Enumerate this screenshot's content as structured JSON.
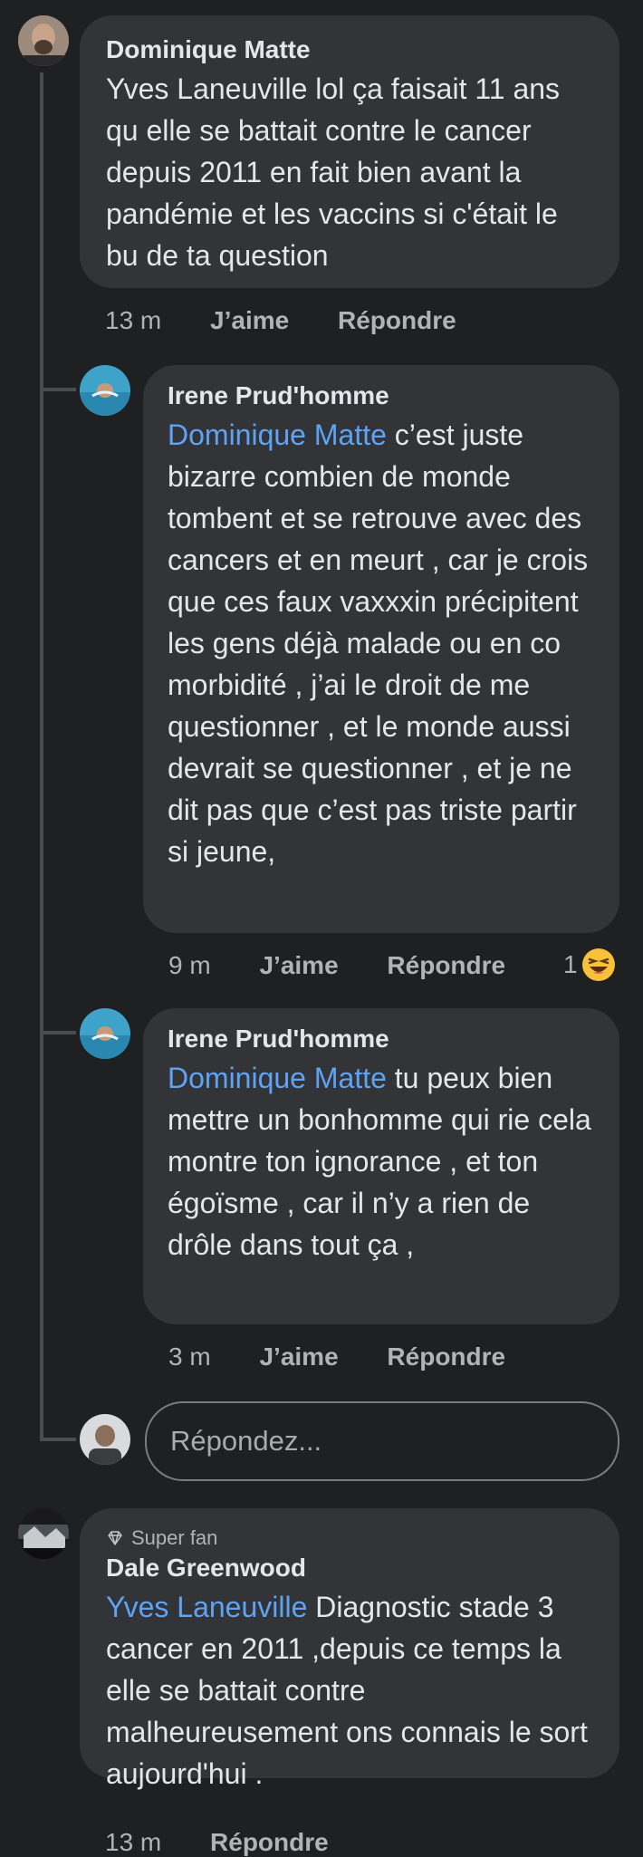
{
  "comments": [
    {
      "author": "Dominique Matte",
      "text": "Yves Laneuville lol ça faisait  11 ans qu elle se battait contre le cancer depuis 2011 en fait bien avant la pandémie et les vaccins si c'était le bu de ta question",
      "time": "13 m",
      "like_label": "J’aime",
      "reply_label": "Répondre"
    },
    {
      "author": "Irene Prud'homme",
      "mention": "Dominique Matte",
      "text": " c’est juste bizarre combien de monde tombent et se retrouve avec des cancers et en meurt , car je crois que ces faux vaxxxin précipitent les gens déjà malade ou en co morbidité , j’ai le droit de me questionner , et le monde aussi devrait se questionner , et je ne dit pas que c’est pas triste partir si jeune,",
      "time": "9 m",
      "like_label": "J’aime",
      "reply_label": "Répondre",
      "reaction_count": "1",
      "reaction_icon": "laughing-face-icon"
    },
    {
      "author": "Irene Prud'homme",
      "mention": "Dominique Matte",
      "text": " tu peux bien mettre un bonhomme qui rie cela montre ton ignorance , et ton égoïsme , car il n’y a rien de drôle dans tout ça ,",
      "time": "3 m",
      "like_label": "J’aime",
      "reply_label": "Répondre"
    },
    {
      "badge_icon": "diamond-icon",
      "badge": "Super fan",
      "author": "Dale Greenwood",
      "mention": "Yves Laneuville",
      "text": " Diagnostic stade 3 cancer en 2011  ,depuis ce temps la elle se battait contre malheureusement ons connais le sort aujourd'hui .",
      "time": "13 m",
      "reply_label": "Répondre"
    }
  ],
  "reply_input": {
    "placeholder": "Répondez..."
  },
  "colors": {
    "background": "#1f2022",
    "bubble": "#333437",
    "mention": "#5fa3f5",
    "meta": "#b0b3b8"
  }
}
